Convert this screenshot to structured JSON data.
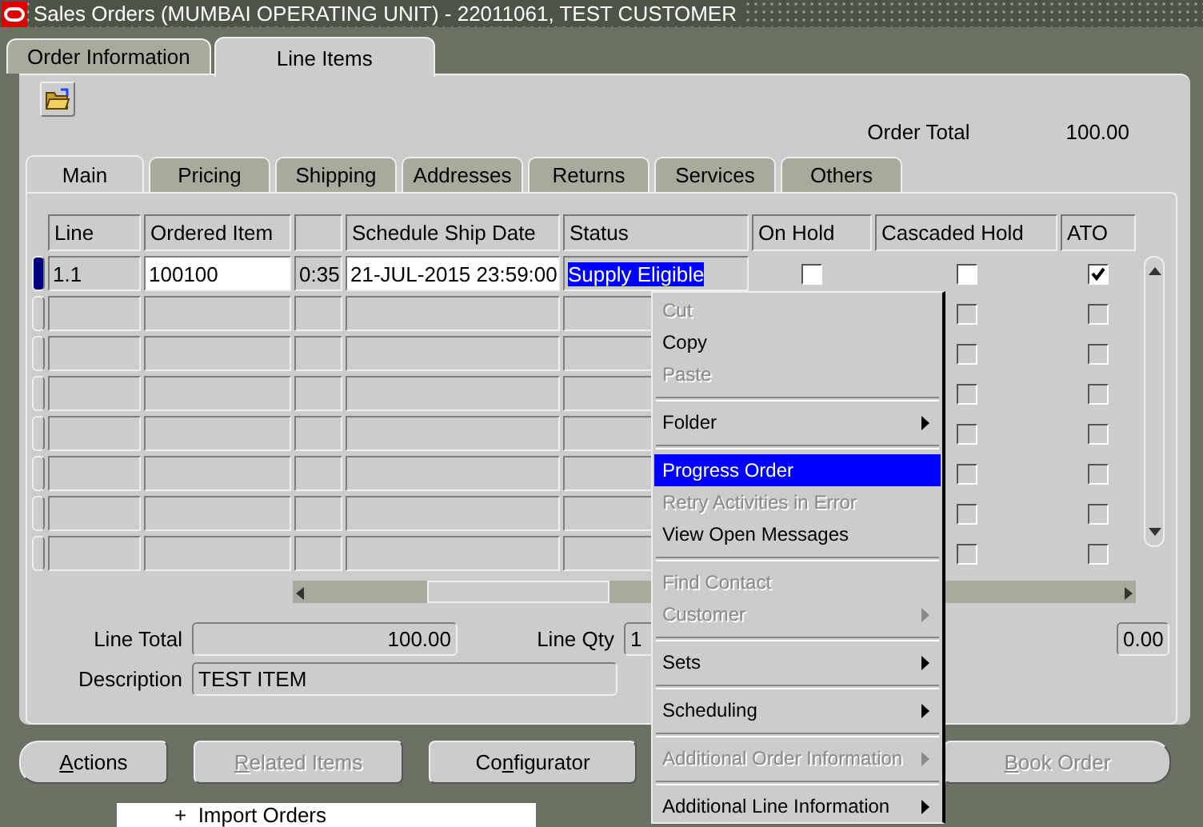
{
  "window": {
    "title": "Sales Orders (MUMBAI OPERATING UNIT) - 22011061, TEST CUSTOMER"
  },
  "tabs": [
    {
      "label": "Order Information",
      "selected": false
    },
    {
      "label": "Line Items",
      "selected": true
    }
  ],
  "order_total": {
    "label": "Order Total",
    "value": "100.00"
  },
  "subtabs": [
    {
      "label": "Main",
      "selected": true
    },
    {
      "label": "Pricing",
      "selected": false
    },
    {
      "label": "Shipping",
      "selected": false
    },
    {
      "label": "Addresses",
      "selected": false
    },
    {
      "label": "Returns",
      "selected": false
    },
    {
      "label": "Services",
      "selected": false
    },
    {
      "label": "Others",
      "selected": false
    }
  ],
  "table": {
    "columns": [
      {
        "label": "Line"
      },
      {
        "label": "Ordered Item"
      },
      {},
      {
        "label": "Schedule Ship Date"
      },
      {
        "label": "Status"
      },
      {
        "label": "On Hold"
      },
      {
        "label": "Cascaded Hold"
      },
      {
        "label": "ATO"
      }
    ],
    "rows": [
      {
        "selected": true,
        "line": "1.1",
        "ordered_item": "100100",
        "column_3": "0:35",
        "schedule_ship_date": "21-JUL-2015 23:59:00",
        "status": "Supply Eligible",
        "on_hold": false,
        "cascaded_hold": false,
        "ato": true
      },
      {
        "selected": false,
        "cascaded_hold": false,
        "ato": false
      },
      {
        "selected": false,
        "cascaded_hold": false,
        "ato": false
      },
      {
        "selected": false,
        "cascaded_hold": false,
        "ato": false
      },
      {
        "selected": false,
        "cascaded_hold": false,
        "ato": false
      },
      {
        "selected": false,
        "cascaded_hold": false,
        "ato": false
      },
      {
        "selected": false,
        "cascaded_hold": false,
        "ato": false
      },
      {
        "selected": false,
        "cascaded_hold": false,
        "ato": false
      }
    ]
  },
  "details": {
    "line_total_label": "Line Total",
    "line_total": "100.00",
    "line_qty_label": "Line Qty",
    "line_qty": "1",
    "field_3": "0.00",
    "description_label": "Description",
    "description": "TEST ITEM"
  },
  "buttons": [
    {
      "key": "A",
      "post": "ctions",
      "disabled": false
    },
    {
      "key": "R",
      "post": "elated Items",
      "disabled": true
    },
    {
      "pre": "Co",
      "key": "n",
      "post": "figurator",
      "disabled": false
    },
    {
      "key": "B",
      "post": "ook Order",
      "disabled": true
    }
  ],
  "navigator": {
    "item": "+  Import Orders"
  },
  "context_menu": {
    "groups": [
      [
        {
          "label": "Cut",
          "disabled": true,
          "submenu": false,
          "selected": false
        },
        {
          "label": "Copy",
          "disabled": false,
          "submenu": false,
          "selected": false
        },
        {
          "label": "Paste",
          "disabled": true,
          "submenu": false,
          "selected": false
        }
      ],
      [
        {
          "label": "Folder",
          "disabled": false,
          "submenu": true,
          "selected": false
        }
      ],
      [
        {
          "label": "Progress Order",
          "disabled": false,
          "submenu": false,
          "selected": true
        },
        {
          "label": "Retry Activities in Error",
          "disabled": true,
          "submenu": false,
          "selected": false
        },
        {
          "label": "View Open Messages",
          "disabled": false,
          "submenu": false,
          "selected": false
        }
      ],
      [
        {
          "label": "Find Contact",
          "disabled": true,
          "submenu": false,
          "selected": false
        },
        {
          "label": "Customer",
          "disabled": true,
          "submenu": true,
          "selected": false
        }
      ],
      [
        {
          "label": "Sets",
          "disabled": false,
          "submenu": true,
          "selected": false
        }
      ],
      [
        {
          "label": "Scheduling",
          "disabled": false,
          "submenu": true,
          "selected": false
        }
      ],
      [
        {
          "label": "Additional Order Information",
          "disabled": true,
          "submenu": true,
          "selected": false
        }
      ],
      [
        {
          "label": "Additional Line Information",
          "disabled": false,
          "submenu": true,
          "selected": false
        }
      ]
    ]
  }
}
